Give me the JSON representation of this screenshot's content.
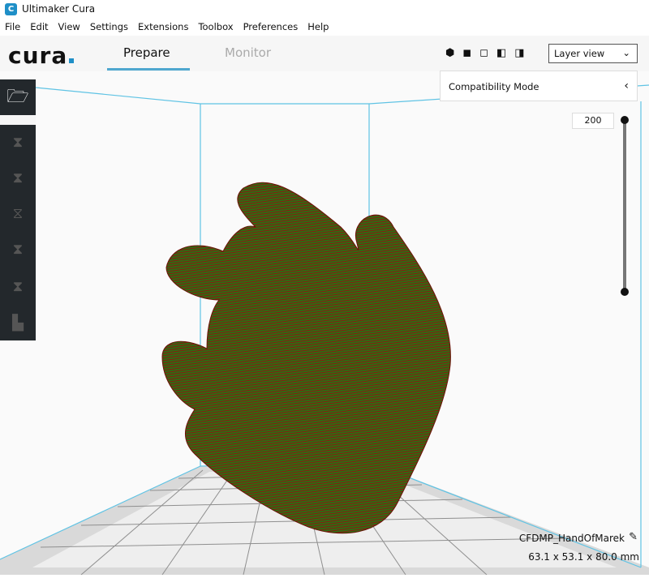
{
  "window": {
    "title": "Ultimaker Cura",
    "icon": "cura-app-icon"
  },
  "menu": [
    "File",
    "Edit",
    "View",
    "Settings",
    "Extensions",
    "Toolbox",
    "Preferences",
    "Help"
  ],
  "header": {
    "logo": "cura",
    "tabs": [
      {
        "label": "Prepare",
        "active": true
      },
      {
        "label": "Monitor",
        "active": false
      }
    ],
    "camera_icons": [
      "3d-view-icon",
      "front-view-icon",
      "top-view-icon",
      "left-view-icon",
      "right-view-icon"
    ],
    "view_select": "Layer view"
  },
  "compat": {
    "label": "Compatibility Mode"
  },
  "layer_slider": {
    "value": "200",
    "max_layer": 200,
    "min_layer": 1
  },
  "sidebar": {
    "tools": [
      "open-file-icon",
      "move-icon",
      "scale-icon",
      "rotate-icon",
      "mirror-icon",
      "per-model-settings-icon",
      "support-blocker-icon"
    ]
  },
  "object": {
    "name": "CFDMP_HandOfMarek",
    "dimensions": "63.1 x 53.1 x 80.0 mm"
  },
  "colors": {
    "accent": "#4fa7cf",
    "model": "#2f6b12",
    "layer_lines": "#8a1a10",
    "build_volume": "#5fc3e4"
  }
}
